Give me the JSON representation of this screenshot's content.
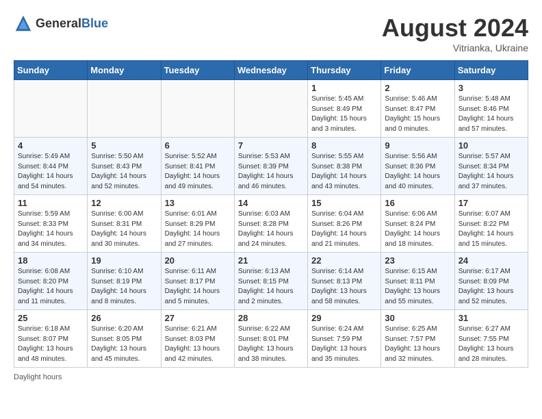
{
  "header": {
    "logo_general": "General",
    "logo_blue": "Blue",
    "month_year": "August 2024",
    "location": "Vitrianka, Ukraine"
  },
  "days_of_week": [
    "Sunday",
    "Monday",
    "Tuesday",
    "Wednesday",
    "Thursday",
    "Friday",
    "Saturday"
  ],
  "footer": {
    "note": "Daylight hours"
  },
  "weeks": [
    [
      {
        "day": "",
        "info": ""
      },
      {
        "day": "",
        "info": ""
      },
      {
        "day": "",
        "info": ""
      },
      {
        "day": "",
        "info": ""
      },
      {
        "day": "1",
        "sunrise": "5:45 AM",
        "sunset": "8:49 PM",
        "daylight": "15 hours and 3 minutes."
      },
      {
        "day": "2",
        "sunrise": "5:46 AM",
        "sunset": "8:47 PM",
        "daylight": "15 hours and 0 minutes."
      },
      {
        "day": "3",
        "sunrise": "5:48 AM",
        "sunset": "8:46 PM",
        "daylight": "14 hours and 57 minutes."
      }
    ],
    [
      {
        "day": "4",
        "sunrise": "5:49 AM",
        "sunset": "8:44 PM",
        "daylight": "14 hours and 54 minutes."
      },
      {
        "day": "5",
        "sunrise": "5:50 AM",
        "sunset": "8:43 PM",
        "daylight": "14 hours and 52 minutes."
      },
      {
        "day": "6",
        "sunrise": "5:52 AM",
        "sunset": "8:41 PM",
        "daylight": "14 hours and 49 minutes."
      },
      {
        "day": "7",
        "sunrise": "5:53 AM",
        "sunset": "8:39 PM",
        "daylight": "14 hours and 46 minutes."
      },
      {
        "day": "8",
        "sunrise": "5:55 AM",
        "sunset": "8:38 PM",
        "daylight": "14 hours and 43 minutes."
      },
      {
        "day": "9",
        "sunrise": "5:56 AM",
        "sunset": "8:36 PM",
        "daylight": "14 hours and 40 minutes."
      },
      {
        "day": "10",
        "sunrise": "5:57 AM",
        "sunset": "8:34 PM",
        "daylight": "14 hours and 37 minutes."
      }
    ],
    [
      {
        "day": "11",
        "sunrise": "5:59 AM",
        "sunset": "8:33 PM",
        "daylight": "14 hours and 34 minutes."
      },
      {
        "day": "12",
        "sunrise": "6:00 AM",
        "sunset": "8:31 PM",
        "daylight": "14 hours and 30 minutes."
      },
      {
        "day": "13",
        "sunrise": "6:01 AM",
        "sunset": "8:29 PM",
        "daylight": "14 hours and 27 minutes."
      },
      {
        "day": "14",
        "sunrise": "6:03 AM",
        "sunset": "8:28 PM",
        "daylight": "14 hours and 24 minutes."
      },
      {
        "day": "15",
        "sunrise": "6:04 AM",
        "sunset": "8:26 PM",
        "daylight": "14 hours and 21 minutes."
      },
      {
        "day": "16",
        "sunrise": "6:06 AM",
        "sunset": "8:24 PM",
        "daylight": "14 hours and 18 minutes."
      },
      {
        "day": "17",
        "sunrise": "6:07 AM",
        "sunset": "8:22 PM",
        "daylight": "14 hours and 15 minutes."
      }
    ],
    [
      {
        "day": "18",
        "sunrise": "6:08 AM",
        "sunset": "8:20 PM",
        "daylight": "14 hours and 11 minutes."
      },
      {
        "day": "19",
        "sunrise": "6:10 AM",
        "sunset": "8:19 PM",
        "daylight": "14 hours and 8 minutes."
      },
      {
        "day": "20",
        "sunrise": "6:11 AM",
        "sunset": "8:17 PM",
        "daylight": "14 hours and 5 minutes."
      },
      {
        "day": "21",
        "sunrise": "6:13 AM",
        "sunset": "8:15 PM",
        "daylight": "14 hours and 2 minutes."
      },
      {
        "day": "22",
        "sunrise": "6:14 AM",
        "sunset": "8:13 PM",
        "daylight": "13 hours and 58 minutes."
      },
      {
        "day": "23",
        "sunrise": "6:15 AM",
        "sunset": "8:11 PM",
        "daylight": "13 hours and 55 minutes."
      },
      {
        "day": "24",
        "sunrise": "6:17 AM",
        "sunset": "8:09 PM",
        "daylight": "13 hours and 52 minutes."
      }
    ],
    [
      {
        "day": "25",
        "sunrise": "6:18 AM",
        "sunset": "8:07 PM",
        "daylight": "13 hours and 48 minutes."
      },
      {
        "day": "26",
        "sunrise": "6:20 AM",
        "sunset": "8:05 PM",
        "daylight": "13 hours and 45 minutes."
      },
      {
        "day": "27",
        "sunrise": "6:21 AM",
        "sunset": "8:03 PM",
        "daylight": "13 hours and 42 minutes."
      },
      {
        "day": "28",
        "sunrise": "6:22 AM",
        "sunset": "8:01 PM",
        "daylight": "13 hours and 38 minutes."
      },
      {
        "day": "29",
        "sunrise": "6:24 AM",
        "sunset": "7:59 PM",
        "daylight": "13 hours and 35 minutes."
      },
      {
        "day": "30",
        "sunrise": "6:25 AM",
        "sunset": "7:57 PM",
        "daylight": "13 hours and 32 minutes."
      },
      {
        "day": "31",
        "sunrise": "6:27 AM",
        "sunset": "7:55 PM",
        "daylight": "13 hours and 28 minutes."
      }
    ]
  ]
}
